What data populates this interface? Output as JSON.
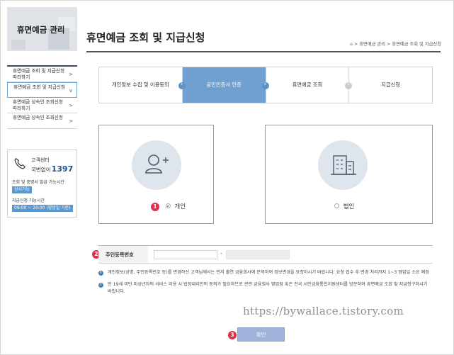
{
  "sidebar": {
    "title": "휴면예금 관리",
    "items": [
      {
        "label": "휴면예금 조회 및 지급신청 따라하기",
        "chevron": ">"
      },
      {
        "label": "휴면예금 조회 및 지급신청",
        "chevron": "v"
      },
      {
        "label": "휴면예금 상속인 조회신청 따라하기",
        "chevron": ">"
      },
      {
        "label": "휴면예금 상속인 조회신청",
        "chevron": ">"
      }
    ],
    "contact": {
      "line1": "고객센터",
      "line2": "국번없이",
      "number": "1397",
      "hours_label": "조회 및 증명서 발급 가능시간",
      "hours_value": "상시가능",
      "apply_label": "지급신청 가능시간",
      "apply_value": "09:00 ~ 20:00 (영업일 기준)"
    }
  },
  "header": {
    "title": "휴면예금 조회 및 지급신청",
    "breadcrumb": "> 휴면예금 관리 > 휴면예금 조회 및 지급신청"
  },
  "steps": [
    {
      "label": "개인정보 수집 및 이용동의",
      "active": false
    },
    {
      "label": "공인인증서 인증",
      "active": true
    },
    {
      "label": "휴면예금 조회",
      "active": false
    },
    {
      "label": "지급신청",
      "active": false
    }
  ],
  "choices": {
    "individual": {
      "label": "개인",
      "marker": "1",
      "selected": true
    },
    "corporate": {
      "label": "법인",
      "selected": false
    }
  },
  "id_field": {
    "marker": "2",
    "label": "주민등록번호",
    "value1": "",
    "dash": "-",
    "value2": ""
  },
  "notes": [
    "개인정보(성명, 주민등록번호 등)를 변경하신 고객님께서는 먼저 출연 금융회사에 문의하여 정보변경을 요청하시기 바랍니다. 요청 접수 후 변경 처리까지 1~3 영업일 소요 예정",
    "만 19세 미만 미성년자의 서비스 이용 시 법정대리인의 동의가 필요하므로 관련 금융회사 영업점 혹은 전국 서민금융통합지원센터를 방문하여 휴면예금 조회 및 지급청구하시기 바랍니다."
  ],
  "watermark": "https://bywallace.tistory.com",
  "confirm": {
    "marker": "3",
    "label": "확인"
  },
  "colors": {
    "step_active": "#6fa0cf",
    "marker_red": "#d9334b",
    "button": "#9fb3da",
    "info_icon": "#3f7fc1"
  }
}
